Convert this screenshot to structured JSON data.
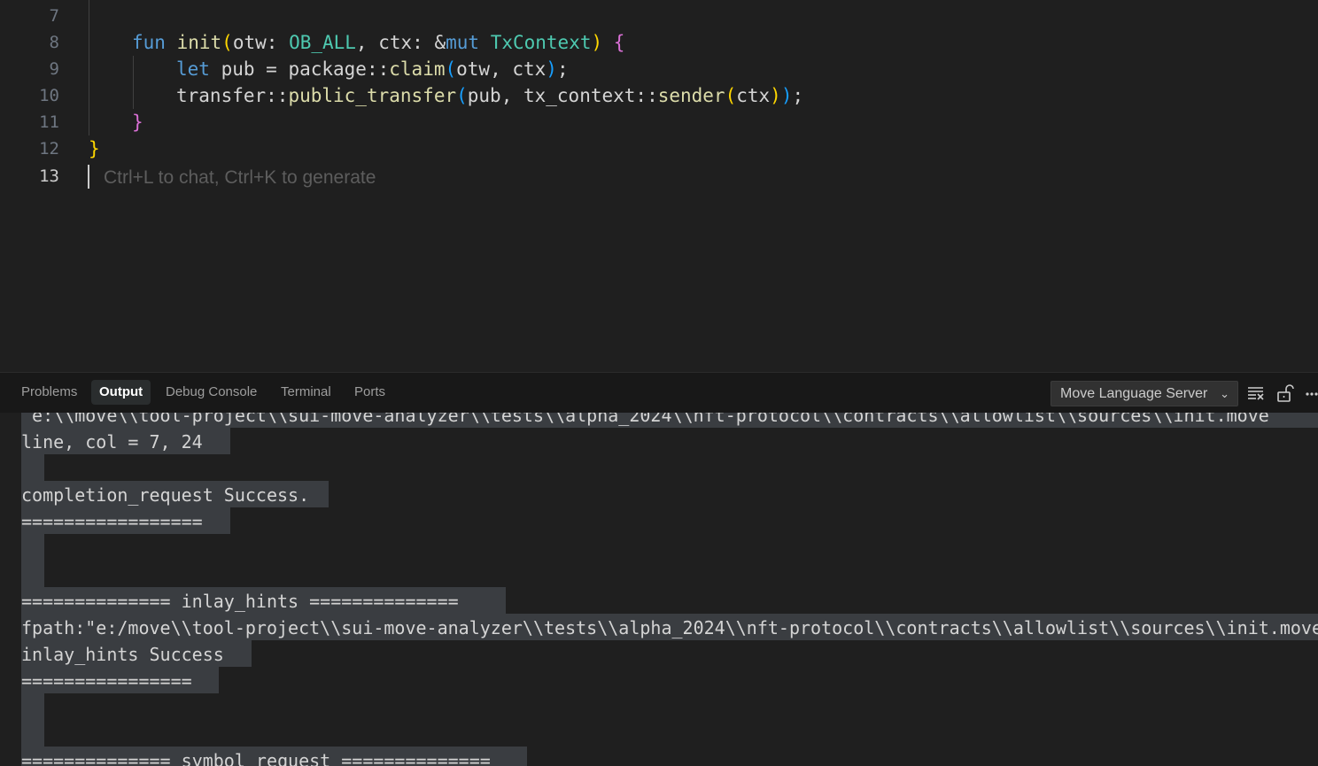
{
  "editor": {
    "line_numbers": [
      "7",
      "8",
      "9",
      "10",
      "11",
      "12",
      "13"
    ],
    "active_line": "13",
    "code": {
      "line8": [
        "fun",
        "init",
        "(",
        "otw",
        ": ",
        "OB_ALL",
        ", ",
        "ctx",
        ": &",
        "mut",
        " ",
        "TxContext",
        ")",
        " {"
      ],
      "line9": [
        "let",
        " pub = ",
        "package",
        "::",
        "claim",
        "(",
        "otw, ctx",
        ")",
        ";"
      ],
      "line10": [
        "transfer",
        "::",
        "public_transfer",
        "(",
        "pub, ",
        "tx_context",
        "::",
        "sender",
        "(",
        "ctx",
        ")",
        ")",
        ";"
      ],
      "line11": "}",
      "line12": "}"
    },
    "inline_hint": "Ctrl+L to chat, Ctrl+K to generate"
  },
  "panel": {
    "tabs": [
      "Problems",
      "Output",
      "Debug Console",
      "Terminal",
      "Ports"
    ],
    "active_tab": "Output",
    "channel": "Move Language Server",
    "icons": [
      "clear-output-icon",
      "lock-scroll-icon",
      "more-actions-icon"
    ]
  },
  "output_lines": [
    " e:\\\\move\\\\tool-project\\\\sui-move-analyzer\\\\tests\\\\alpha_2024\\\\nft-protocol\\\\contracts\\\\allowlist\\\\sources\\\\init.move",
    "line, col = 7, 24",
    "",
    "completion_request Success.",
    "=================",
    "",
    "",
    "============== inlay_hints ==============",
    "fpath:\"e:/move\\\\tool-project\\\\sui-move-analyzer\\\\tests\\\\alpha_2024\\\\nft-protocol\\\\contracts\\\\allowlist\\\\sources\\\\init.move\"",
    "inlay_hints Success",
    "================",
    "",
    "",
    "============== symbol_request =============="
  ],
  "colors": {
    "editor_bg": "#1f1f1f",
    "panel_bg": "#181818",
    "selection": "#3a3d41",
    "keyword": "#569cd6",
    "function": "#dcdcaa",
    "type": "#4ec9b0"
  }
}
